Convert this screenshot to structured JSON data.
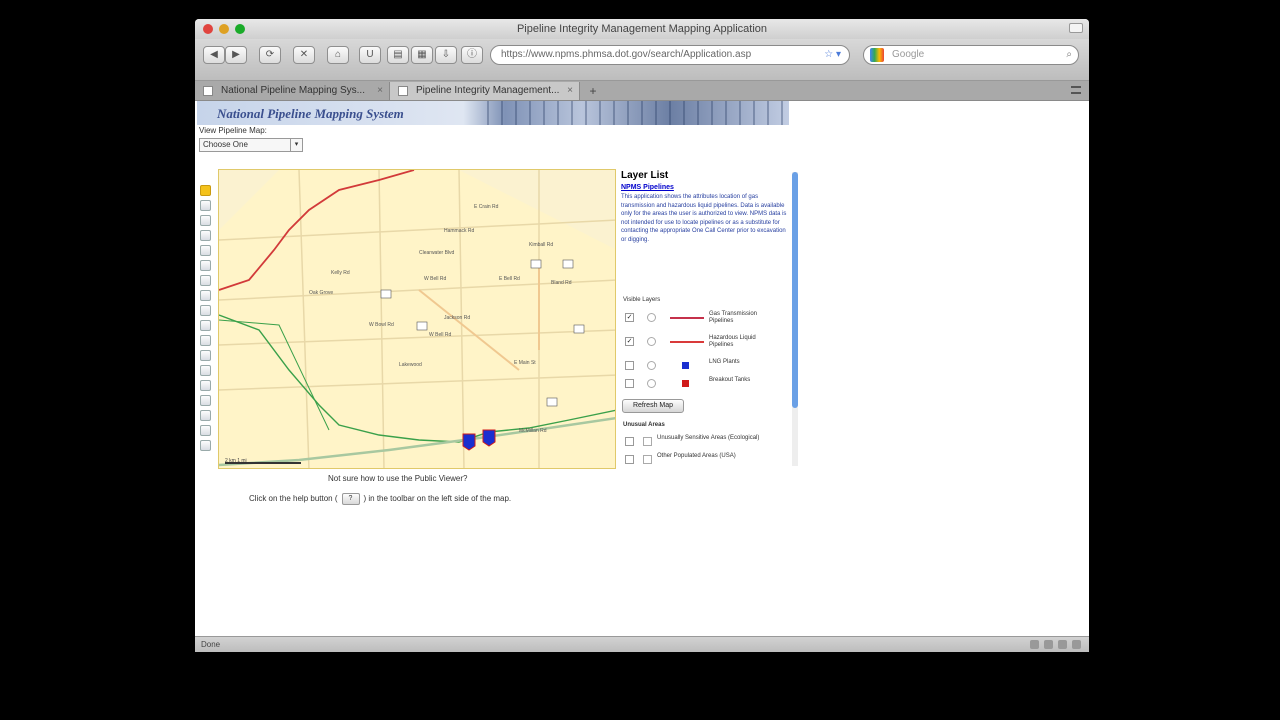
{
  "window": {
    "title": "Pipeline Integrity Management Mapping Application"
  },
  "toolbar": {
    "url": "https://www.npms.phmsa.dot.gov/search/Application.asp",
    "search_placeholder": "Google"
  },
  "tabs": [
    {
      "label": "National Pipeline Mapping Sys..."
    },
    {
      "label": "Pipeline Integrity Management..."
    }
  ],
  "page": {
    "banner_title": "National Pipeline Mapping System",
    "pipeline_label": "View Pipeline Map:",
    "pipeline_select_value": "Choose One",
    "map_labels": [
      "E Crain Rd",
      "Hammack Rd",
      "Kimball Rd",
      "Clearwater Blvd",
      "Kelly Rd",
      "W Bell Rd",
      "E Bell Rd",
      "Oak Grove",
      "Bland Rd",
      "Jackson Rd",
      "W Bowl Rd",
      "W Bell Rd",
      "E Main St",
      "Lakewood",
      "McMillan Rd"
    ],
    "scale_label": "2 km   1 mi",
    "layer_panel": {
      "title": "Layer List",
      "link": "NPMS Pipelines",
      "description": "This application shows the attributes location of gas transmission and hazardous liquid pipelines. Data is available only for the areas the user is authorized to view. NPMS data is not intended for use to locate pipelines or as a substitute for contacting the appropriate One Call Center prior to excavation or digging.",
      "section1": "Visible Layers",
      "layers": [
        {
          "name": "Gas Transmission Pipelines",
          "checked": "✓",
          "color": "#c5314b"
        },
        {
          "name": "Hazardous Liquid Pipelines",
          "checked": "✓",
          "color": "#d93a3a"
        },
        {
          "name": "LNG Plants",
          "checked": "",
          "color": "#1a2fd0"
        },
        {
          "name": "Breakout Tanks",
          "checked": "",
          "color": "#d01a1a"
        }
      ],
      "refresh_label": "Refresh Map",
      "section2": "Unusual Areas",
      "unusual": [
        {
          "name": "Unusually Sensitive Areas (Ecological)"
        },
        {
          "name": "Other Populated Areas (USA)"
        }
      ]
    },
    "help_question": "Not sure how to use the Public Viewer?",
    "help_answer_before": "Click on the help button (",
    "help_answer_after": ") in the toolbar on the left side of the map."
  },
  "status": {
    "text": "Done"
  }
}
